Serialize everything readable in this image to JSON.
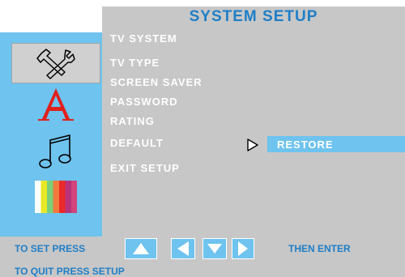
{
  "menu": {
    "title": "SYSTEM SETUP",
    "items": [
      "TV SYSTEM",
      "TV TYPE",
      "SCREEN SAVER",
      "PASSWORD",
      "RATING",
      "DEFAULT",
      "EXIT SETUP"
    ],
    "selected_submenu_option": "RESTORE"
  },
  "sidebar": {
    "icons": [
      "tools-icon",
      "language-icon",
      "music-note-icon",
      "color-bars-icon"
    ]
  },
  "footer": {
    "set_press": "TO SET PRESS",
    "then_enter": "THEN ENTER",
    "quit": "TO QUIT PRESS SETUP"
  },
  "colors": {
    "accent": "#6ec3ef",
    "panel": "#c7c7c7",
    "title_text": "#1f7ec7",
    "language_glyph": "#e0201c"
  }
}
